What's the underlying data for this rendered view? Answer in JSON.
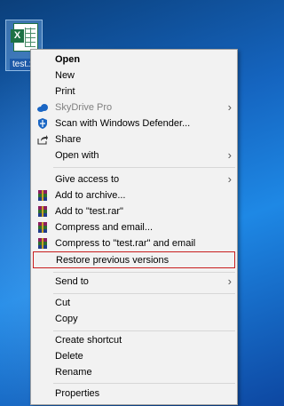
{
  "desktop": {
    "file_label": "test.xlsx",
    "icon_badge": "X"
  },
  "menu": {
    "items": [
      {
        "label": "Open",
        "icon": null,
        "submenu": false,
        "bold": true,
        "disabled": false
      },
      {
        "label": "New",
        "icon": null,
        "submenu": false,
        "bold": false,
        "disabled": false
      },
      {
        "label": "Print",
        "icon": null,
        "submenu": false,
        "bold": false,
        "disabled": false
      },
      {
        "label": "SkyDrive Pro",
        "icon": "cloud-icon",
        "submenu": true,
        "bold": false,
        "disabled": true
      },
      {
        "label": "Scan with Windows Defender...",
        "icon": "defender-shield-icon",
        "submenu": false,
        "bold": false,
        "disabled": false
      },
      {
        "label": "Share",
        "icon": "share-icon",
        "submenu": false,
        "bold": false,
        "disabled": false
      },
      {
        "label": "Open with",
        "icon": null,
        "submenu": true,
        "bold": false,
        "disabled": false
      },
      {
        "label": "Give access to",
        "icon": null,
        "submenu": true,
        "bold": false,
        "disabled": false
      },
      {
        "label": "Add to archive...",
        "icon": "winrar-icon",
        "submenu": false,
        "bold": false,
        "disabled": false
      },
      {
        "label": "Add to \"test.rar\"",
        "icon": "winrar-icon",
        "submenu": false,
        "bold": false,
        "disabled": false
      },
      {
        "label": "Compress and email...",
        "icon": "winrar-icon",
        "submenu": false,
        "bold": false,
        "disabled": false
      },
      {
        "label": "Compress to \"test.rar\" and email",
        "icon": "winrar-icon",
        "submenu": false,
        "bold": false,
        "disabled": false
      },
      {
        "label": "Restore previous versions",
        "icon": null,
        "submenu": false,
        "bold": false,
        "disabled": false
      },
      {
        "label": "Send to",
        "icon": null,
        "submenu": true,
        "bold": false,
        "disabled": false
      },
      {
        "label": "Cut",
        "icon": null,
        "submenu": false,
        "bold": false,
        "disabled": false
      },
      {
        "label": "Copy",
        "icon": null,
        "submenu": false,
        "bold": false,
        "disabled": false
      },
      {
        "label": "Create shortcut",
        "icon": null,
        "submenu": false,
        "bold": false,
        "disabled": false
      },
      {
        "label": "Delete",
        "icon": null,
        "submenu": false,
        "bold": false,
        "disabled": false
      },
      {
        "label": "Rename",
        "icon": null,
        "submenu": false,
        "bold": false,
        "disabled": false
      },
      {
        "label": "Properties",
        "icon": null,
        "submenu": false,
        "bold": false,
        "disabled": false
      }
    ],
    "submenu_arrow": "›"
  },
  "colors": {
    "highlight_border": "#c81e1e",
    "excel_green": "#1e7145",
    "skydrive_blue": "#1a66c4"
  }
}
